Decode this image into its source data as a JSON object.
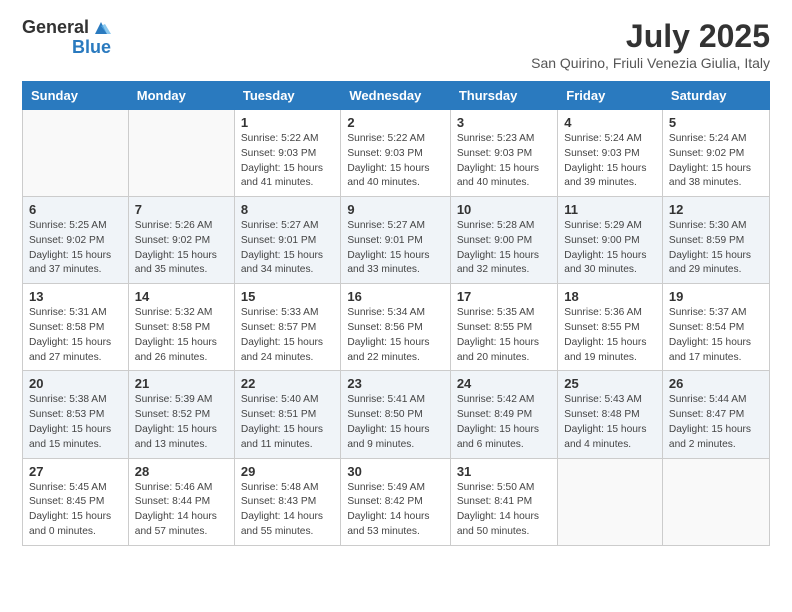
{
  "header": {
    "logo_general": "General",
    "logo_blue": "Blue",
    "month_title": "July 2025",
    "location": "San Quirino, Friuli Venezia Giulia, Italy"
  },
  "weekdays": [
    "Sunday",
    "Monday",
    "Tuesday",
    "Wednesday",
    "Thursday",
    "Friday",
    "Saturday"
  ],
  "weeks": [
    [
      {
        "day": "",
        "sunrise": "",
        "sunset": "",
        "daylight": ""
      },
      {
        "day": "",
        "sunrise": "",
        "sunset": "",
        "daylight": ""
      },
      {
        "day": "1",
        "sunrise": "Sunrise: 5:22 AM",
        "sunset": "Sunset: 9:03 PM",
        "daylight": "Daylight: 15 hours and 41 minutes."
      },
      {
        "day": "2",
        "sunrise": "Sunrise: 5:22 AM",
        "sunset": "Sunset: 9:03 PM",
        "daylight": "Daylight: 15 hours and 40 minutes."
      },
      {
        "day": "3",
        "sunrise": "Sunrise: 5:23 AM",
        "sunset": "Sunset: 9:03 PM",
        "daylight": "Daylight: 15 hours and 40 minutes."
      },
      {
        "day": "4",
        "sunrise": "Sunrise: 5:24 AM",
        "sunset": "Sunset: 9:03 PM",
        "daylight": "Daylight: 15 hours and 39 minutes."
      },
      {
        "day": "5",
        "sunrise": "Sunrise: 5:24 AM",
        "sunset": "Sunset: 9:02 PM",
        "daylight": "Daylight: 15 hours and 38 minutes."
      }
    ],
    [
      {
        "day": "6",
        "sunrise": "Sunrise: 5:25 AM",
        "sunset": "Sunset: 9:02 PM",
        "daylight": "Daylight: 15 hours and 37 minutes."
      },
      {
        "day": "7",
        "sunrise": "Sunrise: 5:26 AM",
        "sunset": "Sunset: 9:02 PM",
        "daylight": "Daylight: 15 hours and 35 minutes."
      },
      {
        "day": "8",
        "sunrise": "Sunrise: 5:27 AM",
        "sunset": "Sunset: 9:01 PM",
        "daylight": "Daylight: 15 hours and 34 minutes."
      },
      {
        "day": "9",
        "sunrise": "Sunrise: 5:27 AM",
        "sunset": "Sunset: 9:01 PM",
        "daylight": "Daylight: 15 hours and 33 minutes."
      },
      {
        "day": "10",
        "sunrise": "Sunrise: 5:28 AM",
        "sunset": "Sunset: 9:00 PM",
        "daylight": "Daylight: 15 hours and 32 minutes."
      },
      {
        "day": "11",
        "sunrise": "Sunrise: 5:29 AM",
        "sunset": "Sunset: 9:00 PM",
        "daylight": "Daylight: 15 hours and 30 minutes."
      },
      {
        "day": "12",
        "sunrise": "Sunrise: 5:30 AM",
        "sunset": "Sunset: 8:59 PM",
        "daylight": "Daylight: 15 hours and 29 minutes."
      }
    ],
    [
      {
        "day": "13",
        "sunrise": "Sunrise: 5:31 AM",
        "sunset": "Sunset: 8:58 PM",
        "daylight": "Daylight: 15 hours and 27 minutes."
      },
      {
        "day": "14",
        "sunrise": "Sunrise: 5:32 AM",
        "sunset": "Sunset: 8:58 PM",
        "daylight": "Daylight: 15 hours and 26 minutes."
      },
      {
        "day": "15",
        "sunrise": "Sunrise: 5:33 AM",
        "sunset": "Sunset: 8:57 PM",
        "daylight": "Daylight: 15 hours and 24 minutes."
      },
      {
        "day": "16",
        "sunrise": "Sunrise: 5:34 AM",
        "sunset": "Sunset: 8:56 PM",
        "daylight": "Daylight: 15 hours and 22 minutes."
      },
      {
        "day": "17",
        "sunrise": "Sunrise: 5:35 AM",
        "sunset": "Sunset: 8:55 PM",
        "daylight": "Daylight: 15 hours and 20 minutes."
      },
      {
        "day": "18",
        "sunrise": "Sunrise: 5:36 AM",
        "sunset": "Sunset: 8:55 PM",
        "daylight": "Daylight: 15 hours and 19 minutes."
      },
      {
        "day": "19",
        "sunrise": "Sunrise: 5:37 AM",
        "sunset": "Sunset: 8:54 PM",
        "daylight": "Daylight: 15 hours and 17 minutes."
      }
    ],
    [
      {
        "day": "20",
        "sunrise": "Sunrise: 5:38 AM",
        "sunset": "Sunset: 8:53 PM",
        "daylight": "Daylight: 15 hours and 15 minutes."
      },
      {
        "day": "21",
        "sunrise": "Sunrise: 5:39 AM",
        "sunset": "Sunset: 8:52 PM",
        "daylight": "Daylight: 15 hours and 13 minutes."
      },
      {
        "day": "22",
        "sunrise": "Sunrise: 5:40 AM",
        "sunset": "Sunset: 8:51 PM",
        "daylight": "Daylight: 15 hours and 11 minutes."
      },
      {
        "day": "23",
        "sunrise": "Sunrise: 5:41 AM",
        "sunset": "Sunset: 8:50 PM",
        "daylight": "Daylight: 15 hours and 9 minutes."
      },
      {
        "day": "24",
        "sunrise": "Sunrise: 5:42 AM",
        "sunset": "Sunset: 8:49 PM",
        "daylight": "Daylight: 15 hours and 6 minutes."
      },
      {
        "day": "25",
        "sunrise": "Sunrise: 5:43 AM",
        "sunset": "Sunset: 8:48 PM",
        "daylight": "Daylight: 15 hours and 4 minutes."
      },
      {
        "day": "26",
        "sunrise": "Sunrise: 5:44 AM",
        "sunset": "Sunset: 8:47 PM",
        "daylight": "Daylight: 15 hours and 2 minutes."
      }
    ],
    [
      {
        "day": "27",
        "sunrise": "Sunrise: 5:45 AM",
        "sunset": "Sunset: 8:45 PM",
        "daylight": "Daylight: 15 hours and 0 minutes."
      },
      {
        "day": "28",
        "sunrise": "Sunrise: 5:46 AM",
        "sunset": "Sunset: 8:44 PM",
        "daylight": "Daylight: 14 hours and 57 minutes."
      },
      {
        "day": "29",
        "sunrise": "Sunrise: 5:48 AM",
        "sunset": "Sunset: 8:43 PM",
        "daylight": "Daylight: 14 hours and 55 minutes."
      },
      {
        "day": "30",
        "sunrise": "Sunrise: 5:49 AM",
        "sunset": "Sunset: 8:42 PM",
        "daylight": "Daylight: 14 hours and 53 minutes."
      },
      {
        "day": "31",
        "sunrise": "Sunrise: 5:50 AM",
        "sunset": "Sunset: 8:41 PM",
        "daylight": "Daylight: 14 hours and 50 minutes."
      },
      {
        "day": "",
        "sunrise": "",
        "sunset": "",
        "daylight": ""
      },
      {
        "day": "",
        "sunrise": "",
        "sunset": "",
        "daylight": ""
      }
    ]
  ]
}
